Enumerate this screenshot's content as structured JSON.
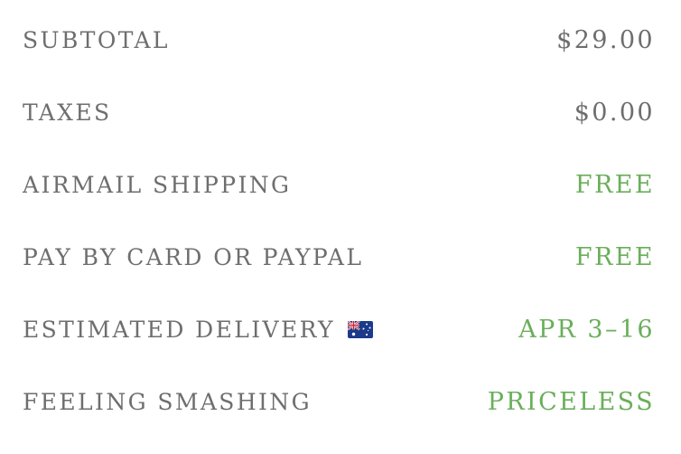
{
  "summary": {
    "rows": [
      {
        "label": "SUBTOTAL",
        "value": "$29.00"
      },
      {
        "label": "TAXES",
        "value": "$0.00"
      },
      {
        "label": "AIRMAIL SHIPPING",
        "value": "FREE"
      },
      {
        "label": "PAY BY CARD OR PAYPAL",
        "value": "FREE"
      },
      {
        "label": "ESTIMATED DELIVERY",
        "value": "APR 3–16",
        "icon": "australia-flag-icon"
      },
      {
        "label": "FEELING SMASHING",
        "value": "PRICELESS"
      }
    ]
  },
  "colors": {
    "label": "#6e6e6e",
    "price": "#6e6e6e",
    "highlight": "#6aae5a"
  }
}
